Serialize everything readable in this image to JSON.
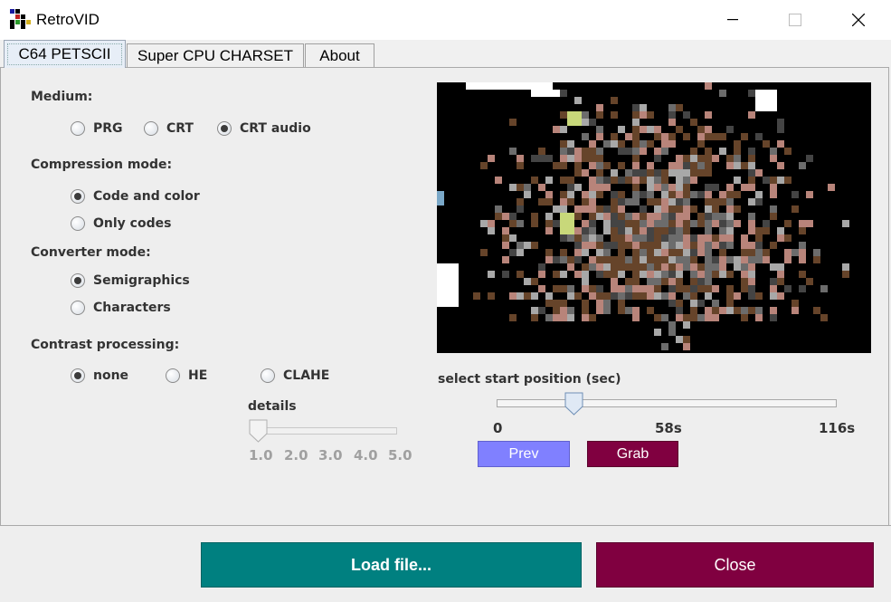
{
  "window": {
    "title": "RetroVID"
  },
  "tabs": [
    {
      "label": "C64 PETSCII"
    },
    {
      "label": "Super CPU CHARSET"
    },
    {
      "label": "About"
    }
  ],
  "medium": {
    "label": "Medium:",
    "options": [
      "PRG",
      "CRT",
      "CRT audio"
    ],
    "selected": "CRT audio"
  },
  "compression": {
    "label": "Compression mode:",
    "options": [
      "Code and color",
      "Only codes"
    ],
    "selected": "Code and color"
  },
  "converter": {
    "label": "Converter mode:",
    "options": [
      "Semigraphics",
      "Characters"
    ],
    "selected": "Semigraphics"
  },
  "contrast": {
    "label": "Contrast processing:",
    "options": [
      "none",
      "HE",
      "CLAHE"
    ],
    "selected": "none"
  },
  "details": {
    "label": "details",
    "ticks": [
      "1.0",
      "2.0",
      "3.0",
      "4.0",
      "5.0"
    ],
    "value": 1.0,
    "enabled": false
  },
  "start_position": {
    "label": "select start position (sec)",
    "ticks": [
      "0",
      "58s",
      "116s"
    ],
    "value_fraction": 0.23
  },
  "buttons": {
    "prev": "Prev",
    "grab": "Grab",
    "load": "Load file...",
    "close": "Close"
  },
  "colors": {
    "prev_bg": "#8080ff",
    "grab_bg": "#800040",
    "load_bg": "#008080",
    "close_bg": "#800040",
    "preview_bg": "#000000",
    "petscii_palette": [
      "#66442a",
      "#b8847a",
      "#a8a8a8",
      "#6c6c6c",
      "#444444",
      "#c8d87a",
      "#ffffff",
      "#7aa8c8"
    ]
  },
  "icons": {
    "app": "retrovid-grid-icon",
    "minimize": "minimize-icon",
    "maximize": "maximize-icon",
    "close": "close-icon"
  }
}
